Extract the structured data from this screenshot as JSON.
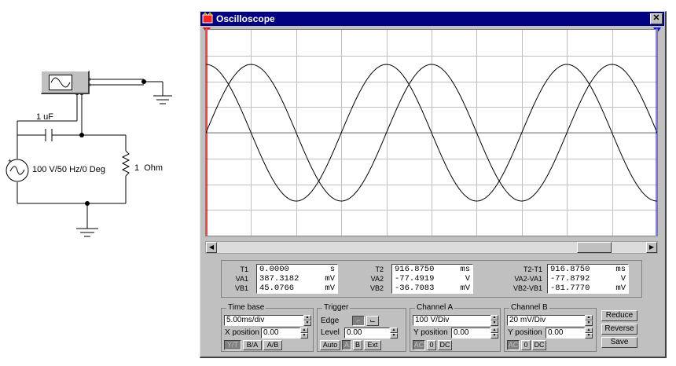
{
  "schematic": {
    "capacitor_label": "1 uF",
    "source_label": "100 V/50 Hz/0 Deg",
    "resistor_label": "1  Ohm"
  },
  "window": {
    "title": "Oscilloscope",
    "close_glyph": "✕",
    "channel_markers": [
      "1",
      "2"
    ]
  },
  "readout": {
    "col1": {
      "labels": [
        "T1",
        "VA1",
        "VB1"
      ],
      "values": [
        "0.0000",
        "387.3182",
        "45.0766"
      ],
      "units": [
        "s",
        "mV",
        "mV"
      ]
    },
    "col2": {
      "labels": [
        "T2",
        "VA2",
        "VB2"
      ],
      "values": [
        "916.8750",
        "-77.4919",
        "-36.7083"
      ],
      "units": [
        "ms",
        "V",
        "mV"
      ]
    },
    "col3": {
      "labels": [
        "T2-T1",
        "VA2-VA1",
        "VB2-VB1"
      ],
      "values": [
        "916.8750",
        "-77.8792",
        "-81.7770"
      ],
      "units": [
        "ms",
        "V",
        "mV"
      ]
    }
  },
  "timebase": {
    "title": "Time base",
    "value": "5.00ms/div",
    "xpos_label": "X position",
    "xpos_value": "0.00",
    "modes": [
      "Y/T",
      "B/A",
      "A/B"
    ]
  },
  "trigger": {
    "title": "Trigger",
    "edge_label": "Edge",
    "level_label": "Level",
    "level_value": "0.00",
    "sources": [
      "Auto",
      "A",
      "B",
      "Ext"
    ]
  },
  "channel_a": {
    "title": "Channel A",
    "value": "100 V/Div",
    "ypos_label": "Y position",
    "ypos_value": "0.00",
    "coupling": [
      "AC",
      "0",
      "DC"
    ]
  },
  "channel_b": {
    "title": "Channel B",
    "value": "20 mV/Div",
    "ypos_label": "Y position",
    "ypos_value": "0.00",
    "coupling": [
      "AC",
      "0",
      "DC"
    ]
  },
  "actions": {
    "reduce": "Reduce",
    "reverse": "Reverse",
    "save": "Save"
  },
  "waves": {
    "period_ms": 20,
    "time_div_ms": 5,
    "divisions": 10,
    "phase_lead_deg": 90
  },
  "colors": {
    "title_bar": "#000080",
    "window": "#c0c0c0",
    "trace": "#000000",
    "cursor1": "#ff0000",
    "cursor2": "#0000ff"
  }
}
